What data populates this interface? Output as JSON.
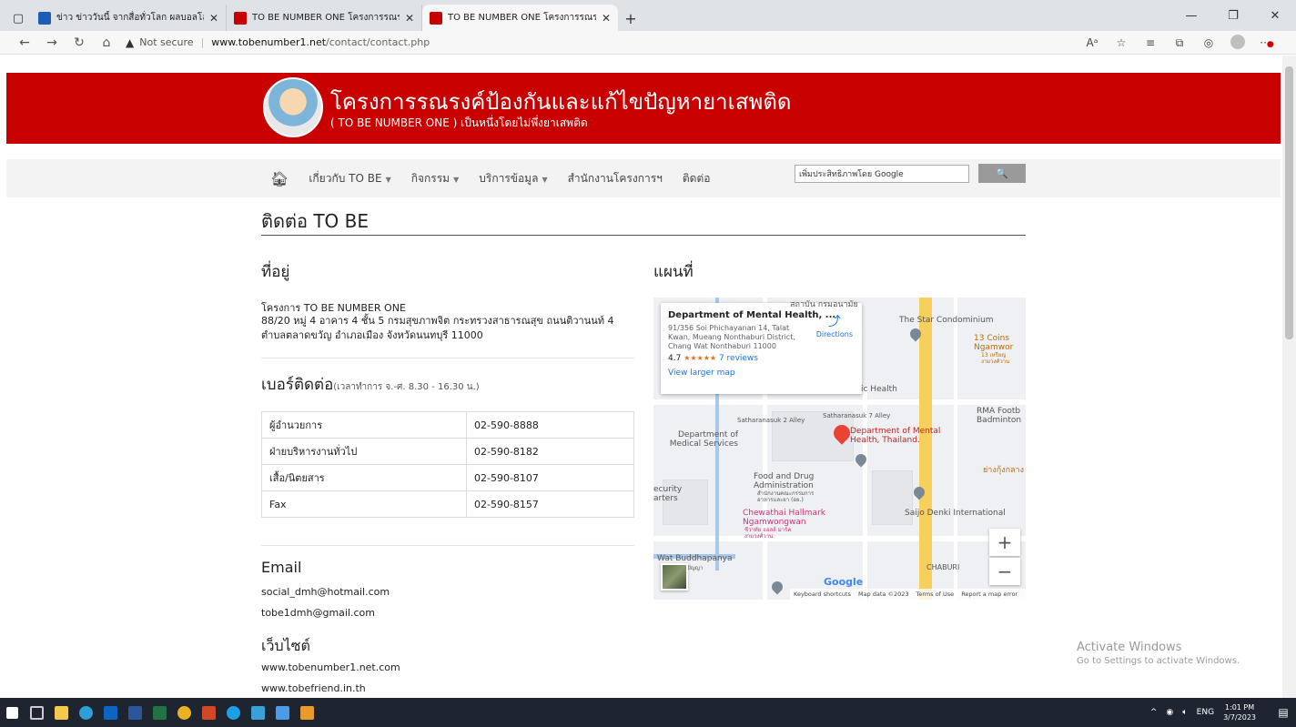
{
  "browser": {
    "tabs": [
      {
        "title": "ข่าว ข่าววันนี้ จากสื่อทั่วโลก ผลบอลโลก",
        "active": false,
        "color": "#1a5fb4"
      },
      {
        "title": "TO BE NUMBER ONE โครงการรณร",
        "active": false,
        "color": "#c80000"
      },
      {
        "title": "TO BE NUMBER ONE โครงการรณร",
        "active": true,
        "color": "#c80000"
      }
    ],
    "not_secure": "Not secure",
    "url_host": "www.tobenumber1.net",
    "url_path": "/contact/contact.php"
  },
  "header": {
    "title": "โครงการรณรงค์ป้องกันและแก้ไขปัญหายาเสพติด",
    "subtitle": "( TO BE NUMBER ONE ) เป็นหนึ่งโดยไม่พึ่งยาเสพติด",
    "brand_color": "#c80000"
  },
  "menu": {
    "items": [
      {
        "label": "เกี่ยวกับ TO BE",
        "dropdown": true
      },
      {
        "label": "กิจกรรม",
        "dropdown": true
      },
      {
        "label": "บริการข้อมูล",
        "dropdown": true
      },
      {
        "label": "สำนักงานโครงการฯ",
        "dropdown": false
      },
      {
        "label": "ติดต่อ",
        "dropdown": false
      }
    ],
    "search_placeholder": "เพิ่มประสิทธิภาพโดย Google",
    "search_button": "🔍"
  },
  "page": {
    "title": "ติดต่อ TO BE",
    "address_heading": "ที่อยู่",
    "map_heading": "แผนที่",
    "org": "โครงการ TO BE NUMBER ONE",
    "address": "88/20 หมู่ 4 อาคาร 4 ชั้น 5 กรมสุขภาพจิต กระทรวงสาธารณสุข ถนนติวานนท์ 4 ตำบลตลาดขวัญ อำเภอเมือง จังหวัดนนทบุรี 11000",
    "phone_heading": "เบอร์ติดต่อ",
    "phone_hours": "(เวลาทำการ จ.-ศ. 8.30 - 16.30 น.)",
    "phones": [
      {
        "name": "ผู้อำนวยการ",
        "number": "02-590-8888"
      },
      {
        "name": "ฝ่ายบริหารงานทั่วไป",
        "number": "02-590-8182"
      },
      {
        "name": "เสื้อ/นิตยสาร",
        "number": "02-590-8107"
      },
      {
        "name": "Fax",
        "number": "02-590-8157"
      }
    ],
    "email_heading": "Email",
    "emails": [
      "social_dmh@hotmail.com",
      "tobe1dmh@gmail.com"
    ],
    "web_heading": "เว็บไซต์",
    "websites": [
      "www.tobenumber1.net.com",
      "www.tobefriend.in.th"
    ]
  },
  "map": {
    "place_name": "Department of Mental Health, ...",
    "place_address": "91/356 Soi Phichayanan 14, Talat Kwan, Mueang Nonthaburi District, Chang Wat Nonthaburi 11000",
    "rating": "4.7",
    "stars": "★★★★★",
    "reviews": "7 reviews",
    "view_larger": "View larger map",
    "directions": "Directions",
    "labels": {
      "star_condo": "The Star Condominium",
      "coins": "13 Coins Ngamwor",
      "coins_th": "13 เหรียญ งามวงศ์วาน",
      "health": "ic Health",
      "rma": "RMA Footb Badminton",
      "alley2": "Satharanasuk 2 Alley",
      "alley7": "Satharanasuk 7 Alley",
      "dept_red": "Department of Mental Health, Thailand.",
      "dept_grey": "Department of Medical Services",
      "fda": "Food and Drug Administration",
      "fda_th": "สำนักงานคณะกรรมการ อาหารและยา (อย.)",
      "security": "ecurity arters",
      "chewathai": "Chewathai Hallmark Ngamwongwan",
      "chewathai_th": "ชีวาทัย ฮอลล์ มาร์ค งามวงศ์วาน",
      "saijo": "Saijo Denki International",
      "wat": "Wat Buddhapanya",
      "wat_th": "วัดพุทธปัญญา",
      "yang": "ย่างกุ้งกลาง",
      "chaburi": "CHABURI",
      "top": "สถาบัน กรมอนามัย"
    },
    "google": "Google",
    "attribution": [
      "Keyboard shortcuts",
      "Map data ©2023",
      "Terms of Use",
      "Report a map error"
    ]
  },
  "watermark": {
    "title": "Activate Windows",
    "subtitle": "Go to Settings to activate Windows."
  },
  "taskbar": {
    "lang": "ENG",
    "time": "1:01 PM",
    "date": "3/7/2023"
  }
}
